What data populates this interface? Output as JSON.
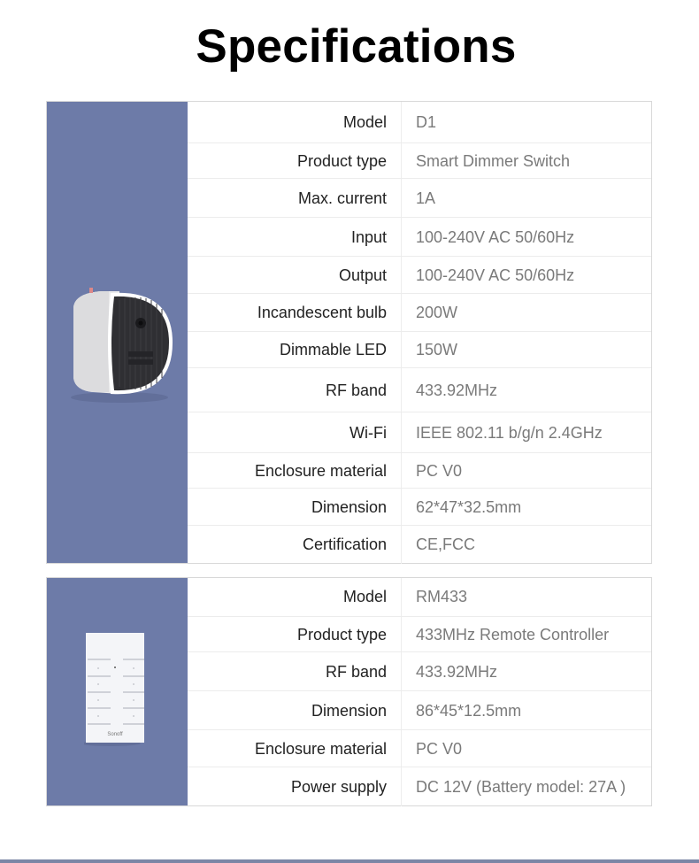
{
  "title": "Specifications",
  "products": [
    {
      "image_icon": "dimmer-switch-device-image",
      "specs": [
        {
          "label": "Model",
          "value": "D1"
        },
        {
          "label": "Product type",
          "value": "Smart Dimmer Switch"
        },
        {
          "label": "Max. current",
          "value": "1A"
        },
        {
          "label": "Input",
          "value": "100-240V AC 50/60Hz"
        },
        {
          "label": "Output",
          "value": "100-240V AC 50/60Hz"
        },
        {
          "label": "Incandescent bulb",
          "value": "200W"
        },
        {
          "label": "Dimmable LED",
          "value": "150W"
        },
        {
          "label": "RF band",
          "value": "433.92MHz"
        },
        {
          "label": "Wi-Fi",
          "value": "IEEE 802.11 b/g/n 2.4GHz"
        },
        {
          "label": "Enclosure material",
          "value": "PC V0"
        },
        {
          "label": "Dimension",
          "value": "62*47*32.5mm"
        },
        {
          "label": "Certification",
          "value": "CE,FCC"
        }
      ]
    },
    {
      "image_icon": "remote-controller-device-image",
      "brand_mark": "Sonoff",
      "specs": [
        {
          "label": "Model",
          "value": "RM433"
        },
        {
          "label": "Product type",
          "value": "433MHz Remote Controller"
        },
        {
          "label": "RF band",
          "value": "433.92MHz"
        },
        {
          "label": "Dimension",
          "value": "86*45*12.5mm"
        },
        {
          "label": "Enclosure material",
          "value": "PC V0"
        },
        {
          "label": "Power supply",
          "value": "DC 12V (Battery model: 27A )"
        }
      ]
    }
  ],
  "colors": {
    "side_panel": "#6d7ba8",
    "label_text": "#222222",
    "value_text": "#7a7a7a"
  }
}
